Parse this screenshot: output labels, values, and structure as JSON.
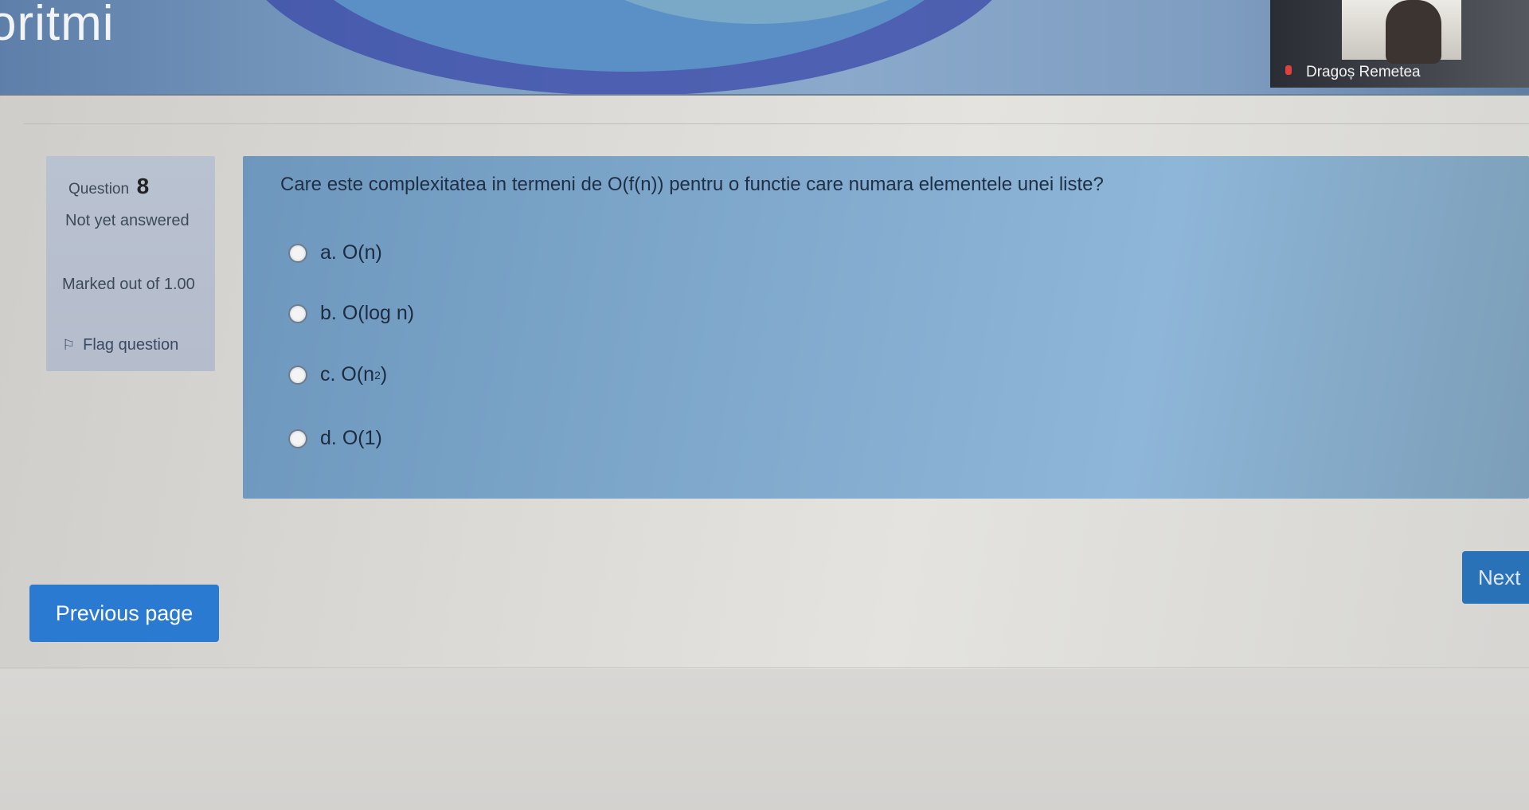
{
  "header": {
    "title": "oritmi"
  },
  "video": {
    "participant_name": "Dragoș Remetea"
  },
  "question_info": {
    "question_word": "Question",
    "question_number": "8",
    "state": "Not yet answered",
    "marked": "Marked out of 1.00",
    "flag_label": "Flag question"
  },
  "question": {
    "text": "Care este complexitatea in termeni de O(f(n)) pentru o functie care numara elementele unei liste?",
    "answers": [
      {
        "prefix": "a.",
        "text": "O(n)"
      },
      {
        "prefix": "b.",
        "text": "O(log n)"
      },
      {
        "prefix": "c.",
        "text": "O(n",
        "sup": "2",
        "suffix": ")"
      },
      {
        "prefix": "d.",
        "text": "O(1)"
      }
    ]
  },
  "navigation": {
    "previous_label": "Previous page",
    "next_label": "Next"
  }
}
